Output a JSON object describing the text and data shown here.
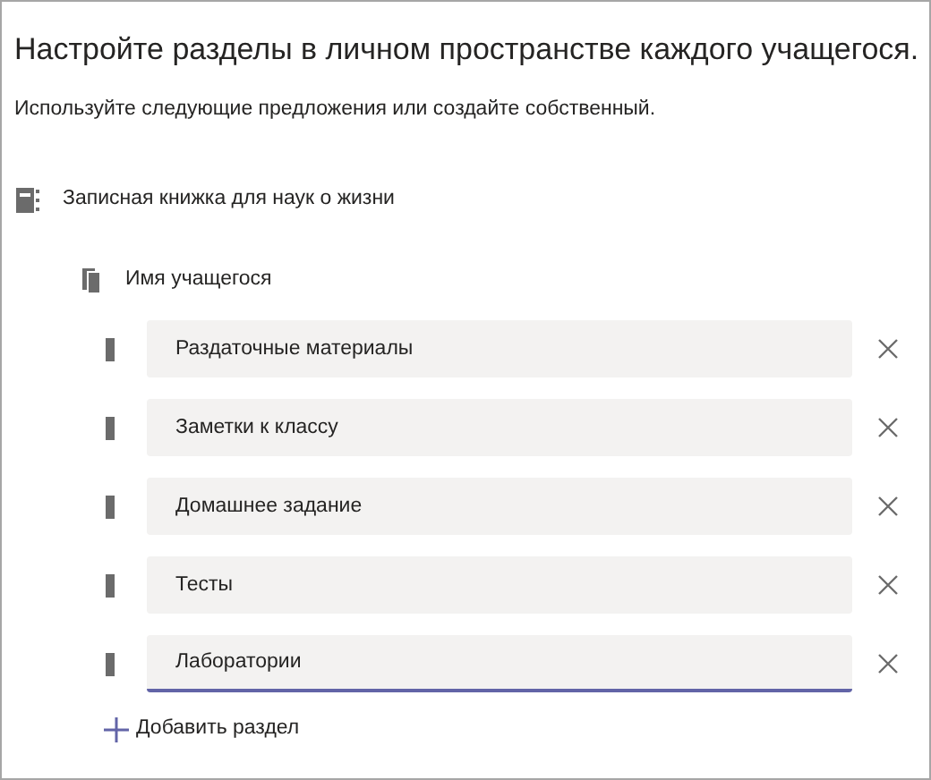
{
  "title": "Настройте разделы в личном пространстве каждого учащегося.",
  "subtitle": "Используйте следующие предложения или создайте собственный.",
  "notebook": {
    "label": "Записная книжка для наук о жизни"
  },
  "student": {
    "label": "Имя учащегося"
  },
  "sections": [
    {
      "value": "Раздаточные материалы",
      "focused": false
    },
    {
      "value": "Заметки к классу",
      "focused": false
    },
    {
      "value": "Домашнее задание",
      "focused": false
    },
    {
      "value": "Тесты",
      "focused": false
    },
    {
      "value": "Лаборатории",
      "focused": true
    }
  ],
  "add_button": {
    "label": "Добавить раздел"
  }
}
